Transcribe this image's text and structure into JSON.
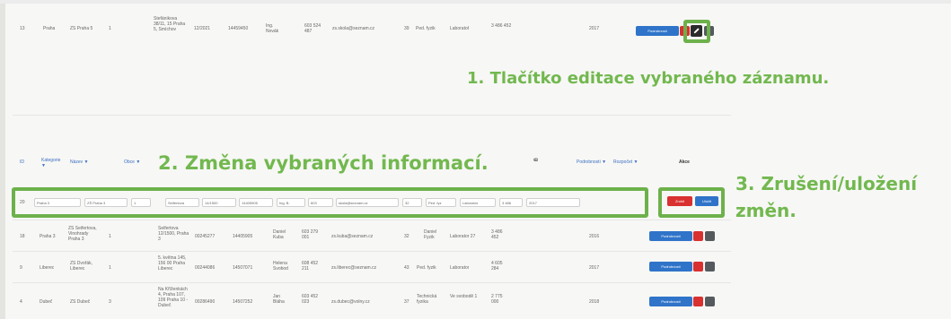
{
  "top_row": {
    "cells": [
      "13",
      "Praha",
      "ZŠ Praha 5",
      "1",
      "Štefánikova 38/11, 15 Praha 5, Smíchov",
      "12/2021",
      "14459450",
      "Ing. Novák",
      "603 524 487",
      "zs.skola@seznam.cz",
      "39",
      "Ped. fyzik",
      "Laboratoř",
      "3 486 452",
      "2017"
    ],
    "detail_label": "Podrobnosti",
    "edit_icon": "pencil-icon"
  },
  "annotations": {
    "a1": "1. Tlačítko editace vybraného záznamu.",
    "a2": "2. Změna vybraných informací.",
    "a3_line1": "3. Zrušení/uložení",
    "a3_line2": "změn."
  },
  "header": {
    "cols": [
      "ID",
      "Kategorie ▼",
      "Název ▼",
      "Obce ▼",
      "ↈ",
      "Podrobnosti ▼",
      "Rozpočet ▼",
      "Akce"
    ]
  },
  "edit_row": {
    "values": [
      "Praha 3",
      "ZŠ Praha 3",
      "1",
      "Seifertova",
      "14/1500",
      "14405905",
      "Ing. B.",
      "603",
      "skola@seznam.cz",
      "32",
      "Ped. fyz",
      "Laborator",
      "3 486",
      "2017"
    ],
    "cancel_label": "Zrušit",
    "save_label": "Uložit"
  },
  "rows": [
    {
      "id": "18",
      "cat": "Praha 3",
      "name": "ZŠ Seifertova, Vinohrady Praha 3",
      "num": "1",
      "addr": "Seifertova 12/1500, Praha 3",
      "c1": "00245277",
      "c2": "14405905",
      "contact": "Daniel Kuba",
      "phone": "603 279 001",
      "mail": "zs.kuba@seznam.cz",
      "n": "32",
      "obor": "Daniel Fyzik",
      "lab": "Laborator 27",
      "budget": "3 486 452",
      "year": "2016",
      "detail_label": "Podrobnosti"
    },
    {
      "id": "9",
      "cat": "Liberec",
      "name": "ZŠ Dvořák, Liberec",
      "num": "1",
      "addr": "5. května 145, 156 00 Praha Liberec",
      "c1": "00244086",
      "c2": "14507071",
      "contact": "Helena Svobod",
      "phone": "608 452 211",
      "mail": "zs.liberec@seznam.cz",
      "n": "43",
      "obor": "Ped. fyzik",
      "lab": "Laborator",
      "budget": "4 605 284",
      "year": "2017",
      "detail_label": "Podrobnosti"
    },
    {
      "id": "4",
      "cat": "Dubeč",
      "name": "ZŠ Dubeč",
      "num": "3",
      "addr": "Na Kříženkách 4, Praha 107, 109 Praha 10 - Dubeč",
      "c1": "00286490",
      "c2": "14507252",
      "contact": "Jan Bláha",
      "phone": "603 452 023",
      "mail": "zs.dubec@volny.cz",
      "n": "37",
      "obor": "Technická fyzika",
      "lab": "Ve svobodě 1",
      "budget": "2 775 000",
      "year": "2018",
      "detail_label": "Podrobnosti"
    }
  ],
  "colors": {
    "annotation_green": "#72b84f",
    "button_blue": "#2f74c9",
    "button_red": "#d93030"
  }
}
